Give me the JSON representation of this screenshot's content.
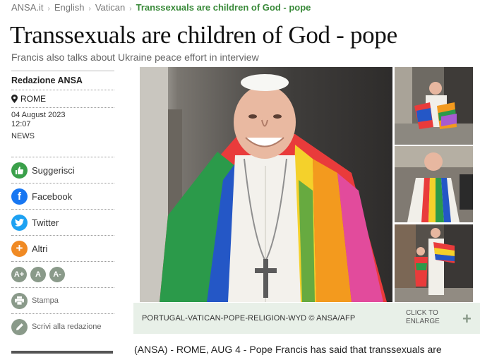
{
  "breadcrumb": {
    "items": [
      "ANSA.it",
      "English",
      "Vatican"
    ],
    "current": "Transsexuals are children of God - pope"
  },
  "article": {
    "title": "Transsexuals are children of God - pope",
    "subtitle": "Francis also talks about Ukraine peace effort in interview",
    "body_start": "(ANSA) - ROME, AUG 4 - Pope Francis has said that transsexuals are"
  },
  "sidebar": {
    "author": "Redazione ANSA",
    "location": "ROME",
    "date": "04 August 2023",
    "time": "12:07",
    "category": "NEWS",
    "share": [
      {
        "label": "Suggerisci",
        "icon": "thumbs-up-icon",
        "color": "#3aa04a"
      },
      {
        "label": "Facebook",
        "icon": "facebook-icon",
        "color": "#1877f2"
      },
      {
        "label": "Twitter",
        "icon": "twitter-icon",
        "color": "#1da1f2"
      },
      {
        "label": "Altri",
        "icon": "plus-icon",
        "color": "#f08a24"
      }
    ],
    "font_sizes": [
      "A+",
      "A",
      "A-"
    ],
    "print_label": "Stampa",
    "write_label": "Scrivi alla redazione"
  },
  "gallery": {
    "caption": "PORTUGAL-VATICAN-POPE-RELIGION-WYD © ANSA/AFP",
    "enlarge_line1": "CLICK TO",
    "enlarge_line2": "ENLARGE"
  }
}
